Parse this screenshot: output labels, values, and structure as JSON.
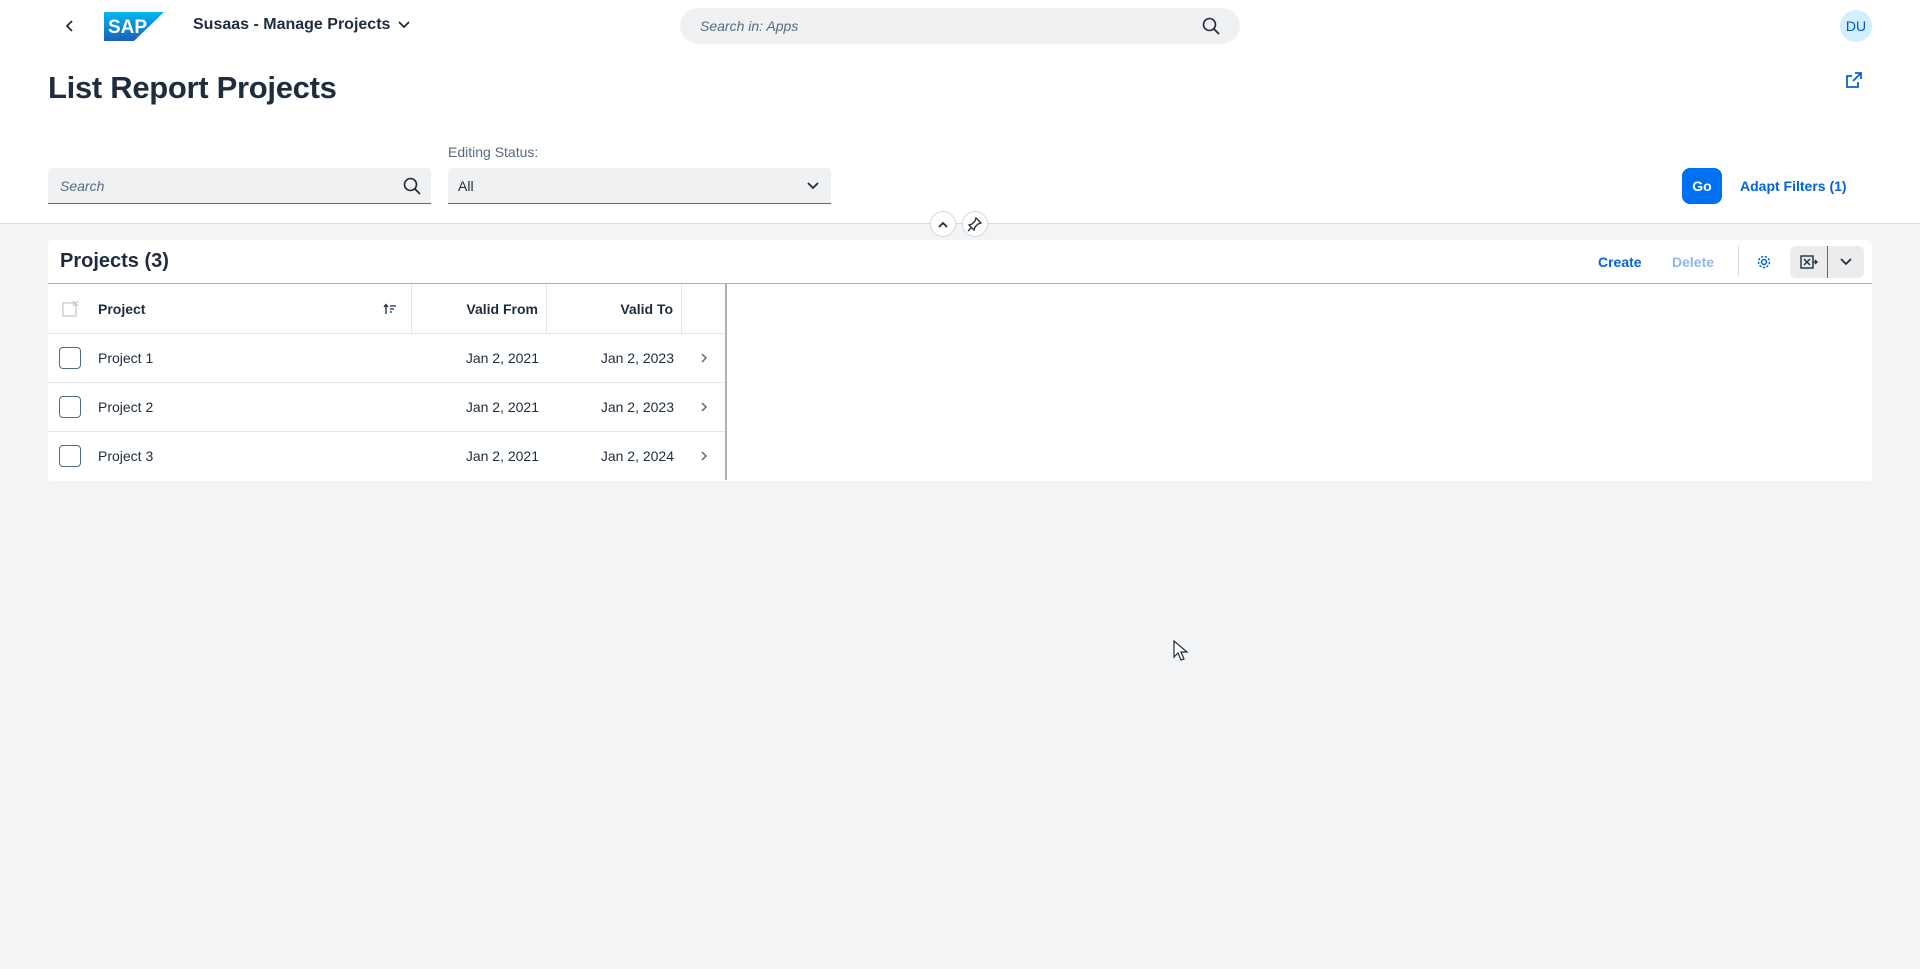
{
  "shell": {
    "app_title": "Susaas - Manage Projects",
    "search_placeholder": "Search in: Apps",
    "avatar_initials": "DU",
    "logo_text": "SAP"
  },
  "header": {
    "title": "List Report Projects",
    "filter_search_placeholder": "Search",
    "editing_status_label": "Editing Status:",
    "editing_status_value": "All",
    "go_label": "Go",
    "adapt_filters_label": "Adapt Filters (1)"
  },
  "table": {
    "title": "Projects (3)",
    "create_label": "Create",
    "delete_label": "Delete",
    "columns": [
      "Project",
      "Valid From",
      "Valid To"
    ],
    "rows": [
      {
        "project": "Project 1",
        "valid_from": "Jan 2, 2021",
        "valid_to": "Jan 2, 2023"
      },
      {
        "project": "Project 2",
        "valid_from": "Jan 2, 2021",
        "valid_to": "Jan 2, 2023"
      },
      {
        "project": "Project 3",
        "valid_from": "Jan 2, 2021",
        "valid_to": "Jan 2, 2024"
      }
    ]
  },
  "colors": {
    "brand_blue": "#0070f2",
    "link_blue": "#0064d9",
    "disabled_blue": "#8fb8ea",
    "background": "#f3f4f6"
  }
}
